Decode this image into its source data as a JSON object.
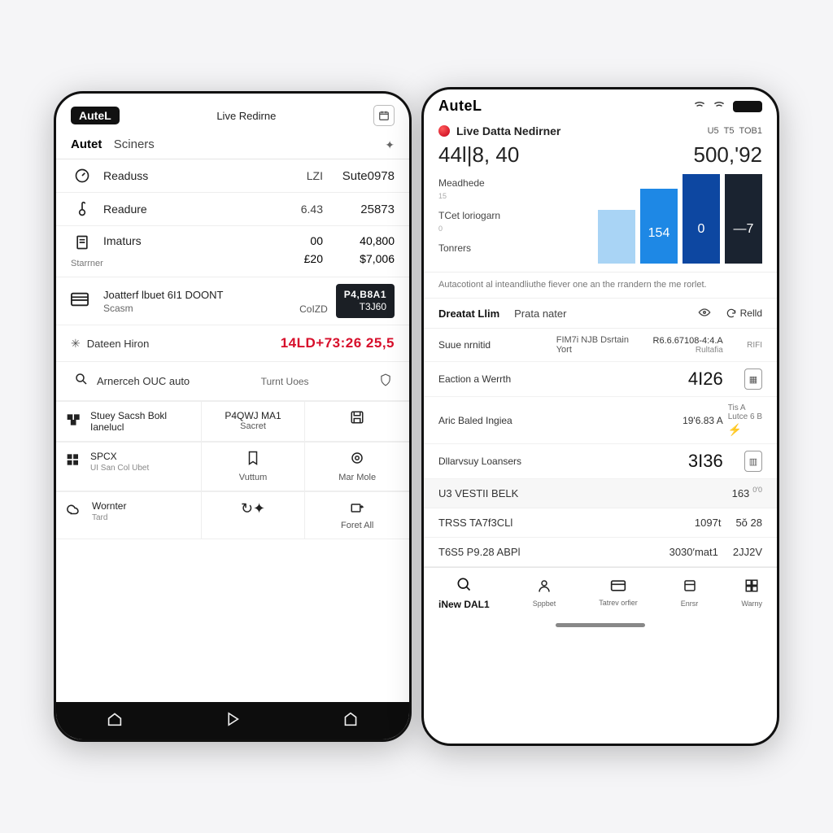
{
  "left": {
    "brand": "AuteL",
    "header_title": "Live Redirne",
    "tabs": {
      "tab1": "Autet",
      "tab2": "Sciners"
    },
    "rows": [
      {
        "label": "Readuss",
        "c1": "LZI",
        "c2": "Sute0978"
      },
      {
        "label": "Readure",
        "c1": "6.43",
        "c2": "25873"
      },
      {
        "label": "Imaturs",
        "sub": "Starrner",
        "c1a": "00",
        "c1b": "£20",
        "c2a": "40,800",
        "c2b": "$7,006"
      }
    ],
    "bidoont": {
      "label1": "Joatterf lbuet 6I1 DOONT",
      "label2": "Scasm",
      "left_val": "CoIZD",
      "badge_top": "P4,B8A1",
      "badge_bot": "T3J60"
    },
    "redrow": {
      "label": "Dateen Hiron",
      "value": "14LD+73:26 25,5"
    },
    "auto": {
      "label": "Arnerceh OUC auto",
      "mid": "Turnt Uoes"
    },
    "tiles": {
      "a": {
        "label": "Stuey Sacsh Bokl Ianelucl"
      },
      "b": {
        "label": "P4QWJ MA1",
        "sub": "Sacret"
      },
      "c": {
        "label": "SPCX",
        "sub": "UI San Col Ubet"
      },
      "d": {
        "label": "Vuttum"
      },
      "e": {
        "label": "Mar Mole"
      },
      "f": {
        "label": "Wornter",
        "sub": "Tard"
      },
      "g": {
        "label": "Foret All"
      }
    }
  },
  "right": {
    "brand": "AuteL",
    "status": {
      "a": "U5",
      "b": "T5",
      "c": "TOB1"
    },
    "live_label": "Live Datta Nedirner",
    "metric_left": "44l|8, 40",
    "metric_right": "500,'92",
    "chart_labels": {
      "a": "Meadhede",
      "b": "TCet loriogarn",
      "c": "Tonrers"
    },
    "caption": "Autacotiont al inteandliuthe fiever one an the rrandern the me rorlet.",
    "subtabs": {
      "t1": "Dreatat Llim",
      "t2": "Prata nater",
      "reld": "Relld"
    },
    "rows": [
      {
        "a": "Suue nrnitid",
        "b": "FIM7i NJB Dsrtain Yort",
        "c": "R6.6.67108-4:4.A",
        "d": "RIFI"
      },
      {
        "a": "Eaction a Werrth",
        "b": "",
        "c_big": "4I26",
        "d": "Rultafia"
      },
      {
        "a": "Aric Baled Ingiea",
        "b": "",
        "c": "19'6.83 A",
        "d_small1": "Tis A",
        "d_small2": "Lutce 6 B"
      },
      {
        "a": "Dllarvsuy Loansers",
        "b": "",
        "c_big": "3I36"
      }
    ],
    "list": [
      {
        "l": "U3 VESTII BELK",
        "r1": "163",
        "sup": "0′0"
      },
      {
        "l": "TRSS TA7f3CLl",
        "r1": "1097t",
        "r2": "5ŏ 28"
      },
      {
        "l": "T6S5 P9.28 ABPl",
        "r1": "3030′mat1",
        "r2": "2JJ2V"
      }
    ],
    "bottomnav": {
      "a": "iNew DAL1",
      "b": "Sppbet",
      "c": "Tatrev orfier",
      "d": "Enrsr",
      "e": "Warny"
    }
  },
  "chart_data": {
    "type": "bar",
    "categories": [
      "b1",
      "b2",
      "b3",
      "b4"
    ],
    "values": [
      66,
      92,
      154,
      null
    ],
    "labels": [
      "",
      "154",
      "0",
      "—7"
    ],
    "title": "Live Datta Nedirner",
    "ylim": [
      0,
      160
    ]
  }
}
